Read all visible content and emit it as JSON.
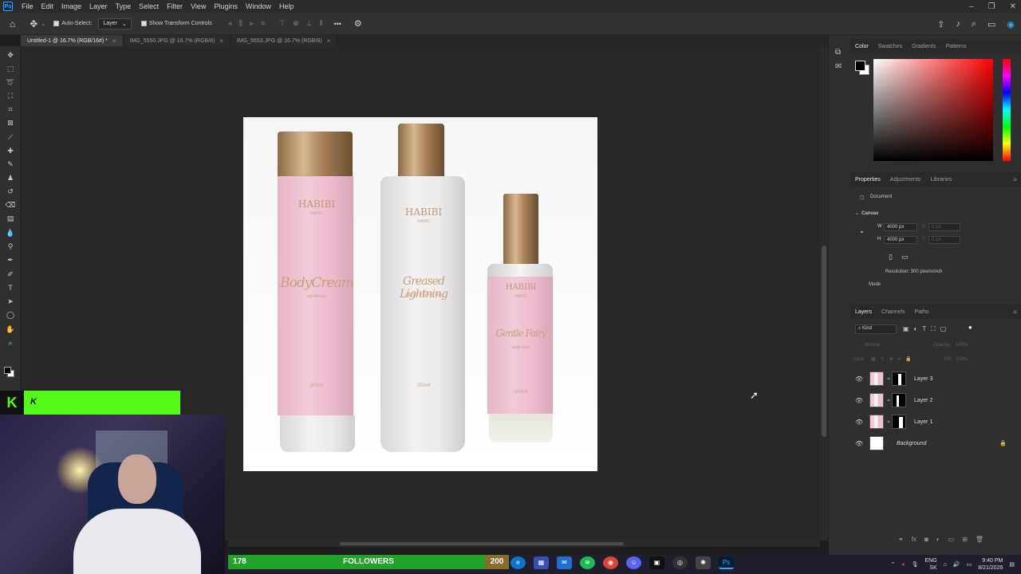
{
  "app": {
    "name": "Ps"
  },
  "menu": [
    "File",
    "Edit",
    "Image",
    "Layer",
    "Type",
    "Select",
    "Filter",
    "View",
    "Plugins",
    "Window",
    "Help"
  ],
  "options": {
    "auto_select": "Auto-Select:",
    "target": "Layer",
    "show_transform": "Show Transform Controls"
  },
  "tabs": [
    {
      "label": "Untitled-1 @ 16.7% (RGB/16#) *",
      "active": true
    },
    {
      "label": "IMG_5550.JPG @ 16.7% (RGB/8)",
      "active": false
    },
    {
      "label": "IMG_5553.JPG @ 16.7% (RGB/8)",
      "active": false
    }
  ],
  "canvas": {
    "products": [
      {
        "brand": "HABIBI",
        "sub": "HAIRC",
        "script": "BodyCream",
        "desc": "conditioner",
        "volume": "200ml"
      },
      {
        "brand": "HABIBI",
        "sub": "HAIRC",
        "script": "Greased Lightning",
        "desc": "shampoo for oily hair",
        "volume": "250ml"
      },
      {
        "brand": "HABIBI",
        "sub": "HAIRC",
        "script": "Gentle Fairy",
        "desc": "scalp tonic",
        "volume": "100ml"
      }
    ]
  },
  "color_panel": {
    "tabs": [
      "Color",
      "Swatches",
      "Gradients",
      "Patterns"
    ]
  },
  "properties_panel": {
    "tabs": [
      "Properties",
      "Adjustments",
      "Libraries"
    ],
    "document_label": "Document",
    "section": "Canvas",
    "w_label": "W",
    "h_label": "H",
    "x_label": "X",
    "y_label": "Y",
    "width": "4000 px",
    "height": "4000 px",
    "x_value": "0 px",
    "y_value": "0 px",
    "resolution": "Resolution: 300 pixels/inch",
    "mode": "Mode"
  },
  "layers_panel": {
    "tabs": [
      "Layers",
      "Channels",
      "Paths"
    ],
    "filter": "Kind",
    "blend": "Normal",
    "opacity_label": "Opacity:",
    "opacity": "100%",
    "lock_label": "Lock:",
    "fill_label": "Fill:",
    "fill": "100%",
    "layers": [
      {
        "name": "Layer 3"
      },
      {
        "name": "Layer 2"
      },
      {
        "name": "Layer 1"
      },
      {
        "name": "Background"
      }
    ]
  },
  "overlay": {
    "brand_letter": "K",
    "followers_count": "178",
    "followers_label": "FOLLOWERS",
    "followers_goal": "200"
  },
  "taskbar": {
    "language": "ENG",
    "region": "SK",
    "time": "9:40 PM",
    "date": "8/21/2026"
  },
  "colors": {
    "accent": "#31a8ff",
    "kick_green": "#53fc18",
    "followers_green": "#21a32a"
  }
}
